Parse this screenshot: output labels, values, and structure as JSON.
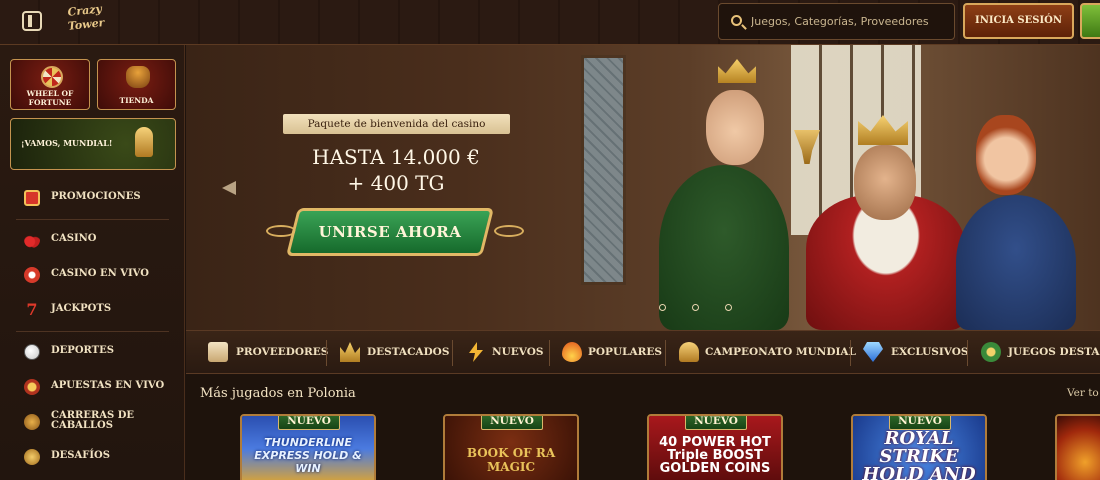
{
  "header": {
    "logo_text": "Crazy Tower",
    "search_placeholder": "Juegos, Categorías, Proveedores",
    "login_label": "INICIA SESIÓN",
    "colors": {
      "accent_gold": "#d9a85c",
      "login_bg": "#7a3010",
      "register_bg": "#5a9a28"
    }
  },
  "sidebar": {
    "tiles": [
      {
        "id": "wheel",
        "label": "WHEEL OF FORTUNE",
        "icon": "wheel-icon"
      },
      {
        "id": "shop",
        "label": "TIENDA",
        "icon": "basket-icon"
      },
      {
        "id": "mundial",
        "label": "¡VAMOS, MUNDIAL!",
        "icon": "trophy-icon"
      }
    ],
    "nav": [
      {
        "label": "PROMOCIONES",
        "icon": "gift-icon"
      },
      {
        "label": "CASINO",
        "icon": "cherry-icon"
      },
      {
        "label": "CASINO EN VIVO",
        "icon": "chip-icon"
      },
      {
        "label": "JACKPOTS",
        "icon": "seven-icon"
      },
      {
        "label": "DEPORTES",
        "icon": "soccer-ball-icon"
      },
      {
        "label": "APUESTAS EN VIVO",
        "icon": "live-icon"
      },
      {
        "label": "CARRERAS DE CABALLOS",
        "icon": "horse-icon"
      },
      {
        "label": "DESAFÍOS",
        "icon": "challenge-icon"
      }
    ]
  },
  "banner": {
    "ribbon": "Paquete de bienvenida del casino",
    "offer_line1": "HASTA 14.000 €",
    "offer_line2": "+ 400 TG",
    "cta": "UNIRSE AHORA",
    "slides_count": 3
  },
  "categories": [
    {
      "label": "PROVEEDORES",
      "icon": "scroll-icon"
    },
    {
      "label": "DESTACADOS",
      "icon": "crown-icon"
    },
    {
      "label": "NUEVOS",
      "icon": "lightning-icon"
    },
    {
      "label": "POPULARES",
      "icon": "flame-icon"
    },
    {
      "label": "CAMPEONATO MUNDIAL",
      "icon": "trophy-icon"
    },
    {
      "label": "EXCLUSIVOS",
      "icon": "diamond-icon"
    },
    {
      "label": "JUEGOS DESTACA",
      "icon": "medal-icon"
    }
  ],
  "games_section": {
    "title": "Más jugados en Polonia",
    "see_all": "Ver to",
    "games": [
      {
        "badge": "NUEVO",
        "title": "THUNDERLINE EXPRESS HOLD & WIN"
      },
      {
        "badge": "NUEVO",
        "title": "BOOK OF RA MAGIC"
      },
      {
        "badge": "NUEVO",
        "title": "40 POWER HOT Triple BOOST GOLDEN COINS"
      },
      {
        "badge": "NUEVO",
        "title": "ROYAL STRIKE HOLD AND WIN"
      },
      {
        "badge": "",
        "title": ""
      }
    ]
  }
}
